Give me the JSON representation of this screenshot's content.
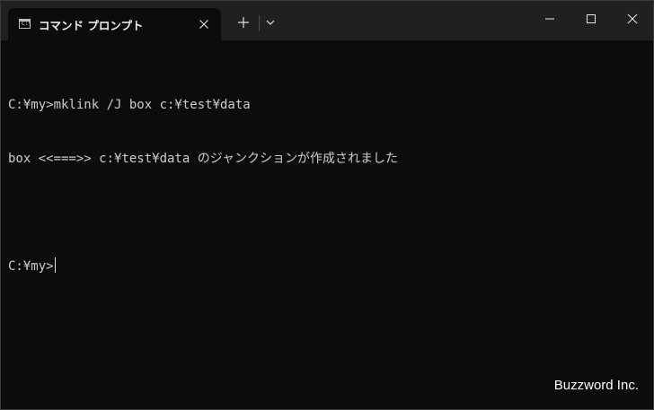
{
  "tab": {
    "title": "コマンド プロンプト",
    "icon_text": "C:\\",
    "close_glyph": "✕"
  },
  "toolbar": {
    "new_tab_glyph": "+"
  },
  "terminal": {
    "lines": [
      "C:¥my>mklink /J box c:¥test¥data",
      "box <<===>> c:¥test¥data のジャンクションが作成されました",
      "",
      "C:¥my>"
    ]
  },
  "watermark": "Buzzword Inc.",
  "colors": {
    "background": "#0c0c0c",
    "titlebar": "#202020",
    "text": "#cccccc"
  },
  "icons": [
    "cmd-icon",
    "close-icon",
    "plus-icon",
    "chevron-down-icon",
    "minimize-icon",
    "maximize-icon",
    "close-window-icon"
  ]
}
